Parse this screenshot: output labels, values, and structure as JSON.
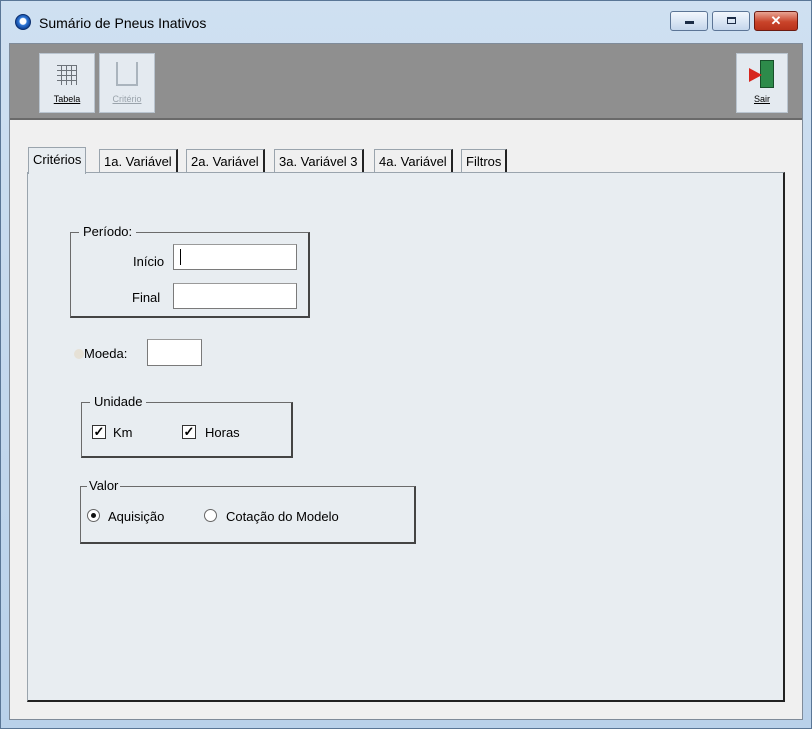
{
  "window": {
    "title": "Sumário de Pneus Inativos"
  },
  "toolbar": {
    "tabela_label": "Tabela",
    "criterio_label": "Critério",
    "sair_label": "Sair"
  },
  "tabs": [
    {
      "label": "Critérios",
      "active": true
    },
    {
      "label": "1a. Variável"
    },
    {
      "label": "2a. Variável"
    },
    {
      "label": "3a. Variável 3"
    },
    {
      "label": "4a. Variável"
    },
    {
      "label": "Filtros"
    }
  ],
  "periodo": {
    "title": "Período:",
    "inicio_label": "Início",
    "inicio_value": "",
    "final_label": "Final",
    "final_value": ""
  },
  "moeda": {
    "label": "Moeda:",
    "value": ""
  },
  "unidade": {
    "title": "Unidade",
    "km_label": "Km",
    "km_checked": true,
    "horas_label": "Horas",
    "horas_checked": true
  },
  "valor": {
    "title": "Valor",
    "aquisicao_label": "Aquisição",
    "cotacao_label": "Cotação do Modelo",
    "selected": "Aquisição"
  }
}
